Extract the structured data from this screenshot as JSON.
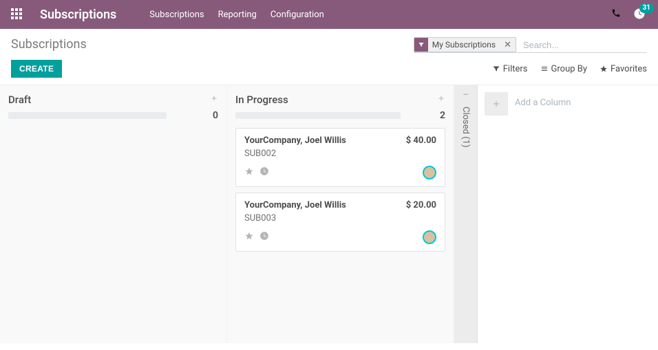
{
  "colors": {
    "brand": "#875A7B",
    "primary_button": "#00A09D"
  },
  "nav": {
    "brand": "Subscriptions",
    "menu": [
      "Subscriptions",
      "Reporting",
      "Configuration"
    ],
    "badge_count": "31"
  },
  "breadcrumb": "Subscriptions",
  "search": {
    "facet_label": "My Subscriptions",
    "placeholder": "Search..."
  },
  "search_options": {
    "filters": "Filters",
    "group_by": "Group By",
    "favorites": "Favorites"
  },
  "buttons": {
    "create": "CREATE"
  },
  "kanban": {
    "columns": [
      {
        "title": "Draft",
        "count": "0",
        "cards": []
      },
      {
        "title": "In Progress",
        "count": "2",
        "cards": [
          {
            "title": "YourCompany, Joel Willis",
            "amount": "$ 40.00",
            "code": "SUB002"
          },
          {
            "title": "YourCompany, Joel Willis",
            "amount": "$ 20.00",
            "code": "SUB003"
          }
        ]
      }
    ],
    "folded": {
      "title": "Closed (1)"
    },
    "add_column_label": "Add a Column"
  }
}
